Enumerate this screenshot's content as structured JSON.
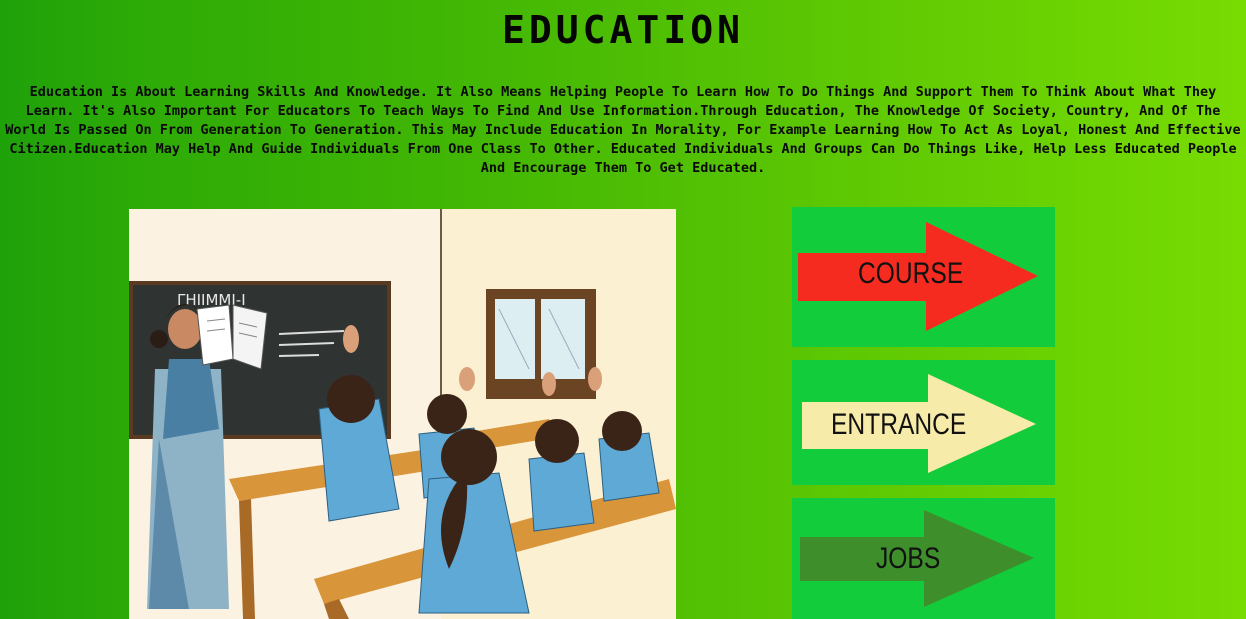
{
  "page": {
    "title": "EDUCATION",
    "intro": "Education Is About Learning Skills And Knowledge. It Also Means Helping People To Learn How To Do Things And Support Them To Think About What They Learn. It's Also Important For Educators To Teach Ways To Find And Use Information.Through Education, The Knowledge Of Society, Country, And Of The World Is Passed On From Generation To Generation. This May Include Education In Morality, For Example Learning How To Act As Loyal, Honest And Effective Citizen.Education May Help And Guide Individuals From One Class To Other. Educated Individuals And Groups Can Do Things Like, Help Less Educated People And Encourage Them To Get Educated."
  },
  "illustration": {
    "blackboard_text": "ΓHIIMMI-I"
  },
  "nav": {
    "course": {
      "label": "COURSE",
      "color": "#f52b20"
    },
    "entrance": {
      "label": "ENTRANCE",
      "color": "#f6eba8"
    },
    "jobs": {
      "label": "JOBS",
      "color": "#3e8f2c"
    }
  },
  "colors": {
    "card_background": "#12cc3c",
    "page_gradient_start": "#1fa10a",
    "page_gradient_end": "#78dc02"
  }
}
